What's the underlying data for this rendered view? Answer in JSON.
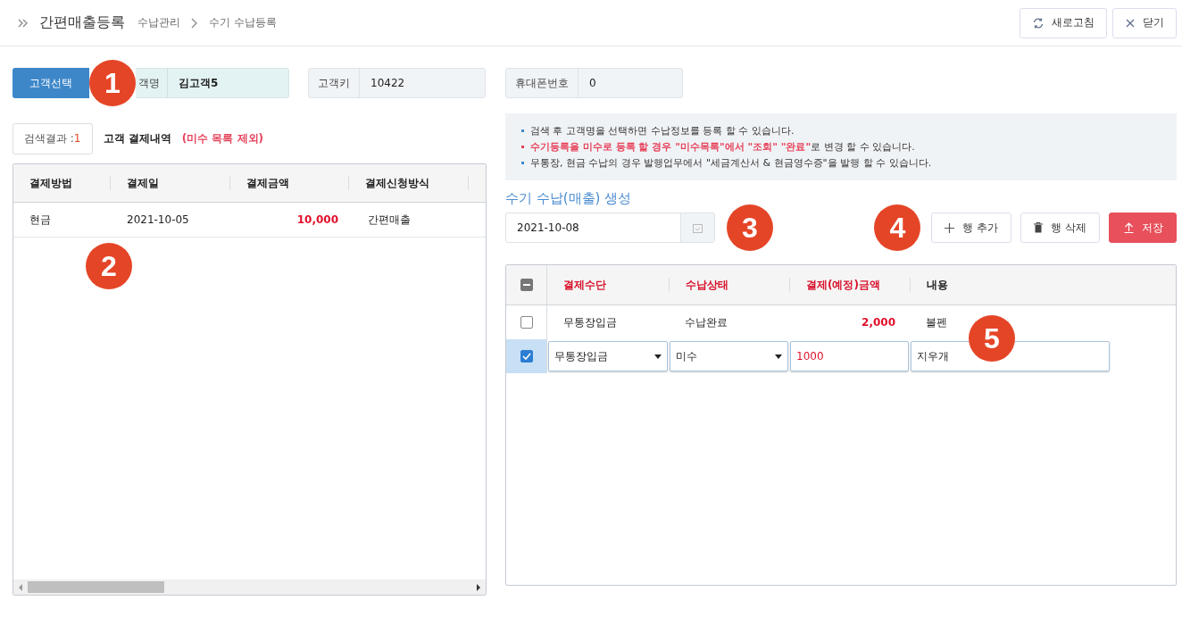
{
  "header": {
    "title": "간편매출등록",
    "breadcrumb": [
      "수납관리",
      "수기 수납등록"
    ],
    "buttons": [
      {
        "label": "새로고침",
        "kind": "refresh"
      },
      {
        "label": "닫기",
        "kind": "close"
      }
    ]
  },
  "customer": {
    "marker": "1",
    "select_button": "고객선택",
    "name_label": "객명",
    "name": "김고객5",
    "key_label": "고객키",
    "key": "10422",
    "phone_label": "휴대폰번호",
    "phone": "0"
  },
  "history": {
    "marker": "2",
    "result_label": "검색결과 :",
    "result_count": "1",
    "title": "고객 결제내역",
    "note": "(미수 목록 제외)",
    "columns": [
      "결제방법",
      "결제일",
      "결제금액",
      "결제신청방식"
    ],
    "rows": [
      {
        "method": "현금",
        "date": "2021-10-05",
        "amount": "10,000",
        "channel": "간편매출"
      }
    ]
  },
  "notices": [
    {
      "text": "검색 후 고객명을 선택하면 수납정보를 등록 할 수 있습니다.",
      "kind": "normal"
    },
    {
      "text": "**수기등록을 미수로 등록 할 경우 \"미수목록\"에서 \"조회\" \"완료\"**로 변경 할 수 있습니다.",
      "kind": "warning"
    },
    {
      "text": "무통장, 현금 수납의 경우 발행업무에서 \"세금계산서 & 현금영수증\"을 발행 할 수 있습니다.",
      "kind": "normal"
    }
  ],
  "form": {
    "title": "수기 수납(매출) 생성",
    "date": "2021-10-08",
    "date_marker": "3",
    "buttons_marker": "4",
    "buttons": [
      {
        "label": "행 추가",
        "kind": "add"
      },
      {
        "label": "행 삭제",
        "kind": "delete"
      },
      {
        "label": "저장",
        "kind": "save"
      }
    ]
  },
  "entry_table": {
    "marker": "5",
    "select_all_mixed": true,
    "columns": [
      {
        "label": "결제수단",
        "required": true
      },
      {
        "label": "수납상태",
        "required": true
      },
      {
        "label": "결제(예정)금액",
        "required": true
      },
      {
        "label": "내용",
        "required": false
      }
    ],
    "rows": [
      {
        "kind": "view",
        "selected": false,
        "method": "무통장입금",
        "status": "수납완료",
        "amount": "2,000",
        "memo": "볼펜"
      },
      {
        "kind": "edit",
        "selected": true,
        "method": "무통장입금",
        "status": "미수",
        "amount": "1000",
        "memo": "지우개"
      }
    ]
  }
}
